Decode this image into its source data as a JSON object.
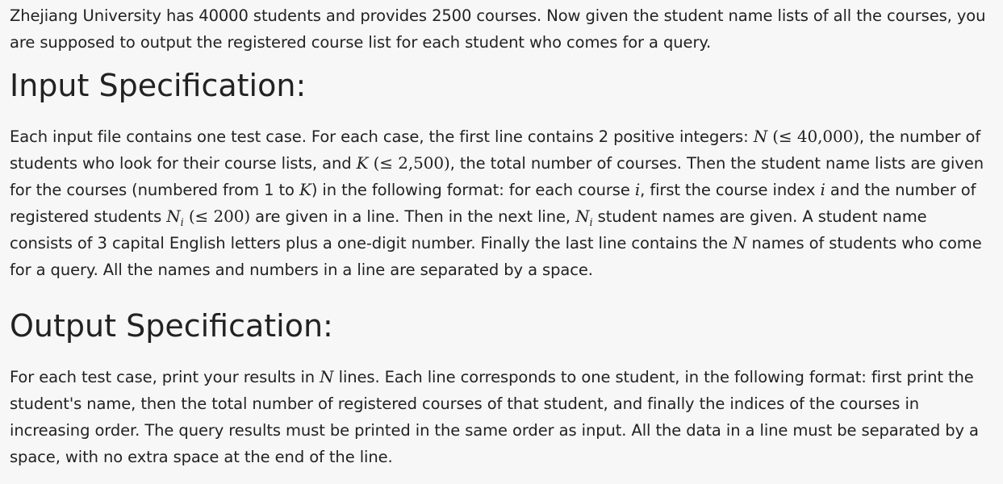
{
  "intro": "Zhejiang University has 40000 students and provides 2500 courses. Now given the student name lists of all the courses, you are supposed to output the registered course list for each student who comes for a query.",
  "input_spec": {
    "heading": "Input Specification:",
    "t1": "Each input file contains one test case. For each case, the first line contains 2 positive integers: ",
    "m1": "N",
    "m2": "(≤ 40,000)",
    "t2": ", the number of students who look for their course lists, and ",
    "m3": "K",
    "m4": "(≤ 2,500)",
    "t3": ", the total number of courses. Then the student name lists are given for the courses (numbered from 1 to ",
    "m5": "K",
    "t4": ") in the following format: for each course ",
    "m6": "i",
    "t5": ", first the course index ",
    "m7": "i",
    "t6": " and the number of registered students ",
    "m8": "N",
    "m8_sub": "i",
    "m9": "(≤ 200)",
    "t7": " are given in a line. Then in the next line, ",
    "m10": "N",
    "m10_sub": "i",
    "t8": " student names are given. A student name consists of 3 capital English letters plus a one-digit number. Finally the last line contains the ",
    "m11": "N",
    "t9": " names of students who come for a query. All the names and numbers in a line are separated by a space."
  },
  "output_spec": {
    "heading": "Output Specification:",
    "t1": "For each test case, print your results in ",
    "m1": "N",
    "t2": " lines. Each line corresponds to one student, in the following format: first print the student's name, then the total number of registered courses of that student, and finally the indices of the courses in increasing order. The query results must be printed in the same order as input. All the data in a line must be separated by a space, with no extra space at the end of the line."
  }
}
